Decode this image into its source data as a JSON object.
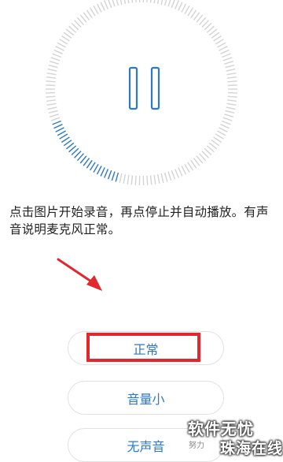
{
  "recorder": {
    "state_icon": "pause-icon",
    "accent_color": "#2f78c4"
  },
  "instruction": "点击图片开始录音，再点停止并自动播放。有声音说明麦克风正常。",
  "buttons": {
    "normal": "正常",
    "low_volume": "音量小",
    "no_sound": "无声音"
  },
  "watermark": {
    "line1": "软件无忧",
    "line2": "珠海在线",
    "small": "努力"
  },
  "annotation_color": "#e0282e"
}
